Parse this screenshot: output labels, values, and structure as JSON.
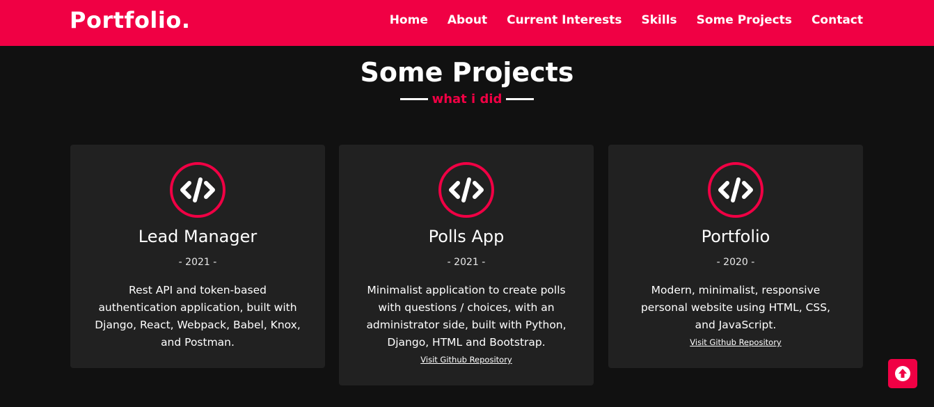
{
  "brand": {
    "logo": "Portfolio."
  },
  "nav": {
    "items": [
      {
        "label": "Home"
      },
      {
        "label": "About"
      },
      {
        "label": "Current Interests"
      },
      {
        "label": "Skills"
      },
      {
        "label": "Some Projects"
      },
      {
        "label": "Contact"
      }
    ]
  },
  "section": {
    "title": "Some Projects",
    "subtitle": "what i did"
  },
  "projects": [
    {
      "icon": "code-icon",
      "title": "Lead Manager",
      "year": "- 2021 -",
      "description": "Rest API and token-based authentication application, built with Django, React, Webpack, Babel, Knox, and Postman.",
      "link": ""
    },
    {
      "icon": "code-icon",
      "title": "Polls App",
      "year": "- 2021 -",
      "description": "Minimalist application to create polls with questions / choices, with an administrator side, built with Python, Django, HTML and Bootstrap.",
      "link": "Visit Github Repository"
    },
    {
      "icon": "code-icon",
      "title": "Portfolio",
      "year": "- 2020 -",
      "description": "Modern, minimalist, responsive personal website using HTML, CSS, and JavaScript.",
      "link": "Visit Github Repository"
    }
  ],
  "scroll_top": {
    "icon": "arrow-up-icon"
  },
  "colors": {
    "accent": "#f00044",
    "background": "#111111",
    "card": "#212121"
  }
}
